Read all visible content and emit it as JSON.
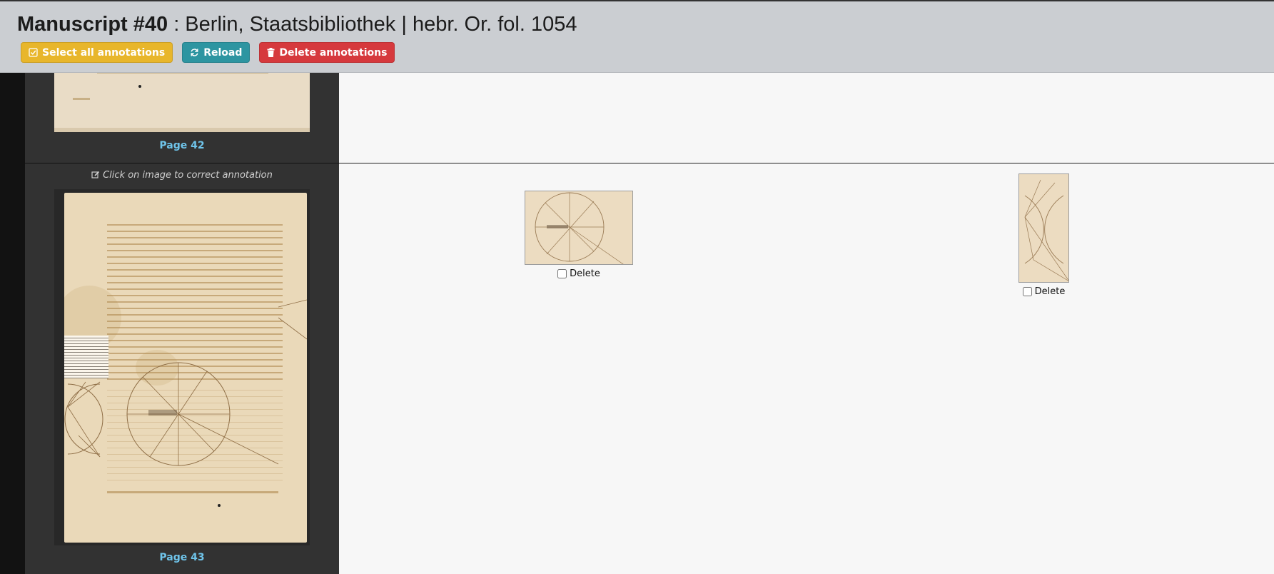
{
  "header": {
    "manuscript_label": "Manuscript #40",
    "manuscript_source": " : Berlin, Staatsbibliothek | hebr. Or. fol. 1054",
    "buttons": {
      "select_all": "Select all annotations",
      "reload": "Reload",
      "delete": "Delete annotations"
    }
  },
  "pages": [
    {
      "label": "Page 42"
    },
    {
      "label": "Page 43",
      "hint": "Click on image to correct annotation"
    }
  ],
  "annotations": [
    {
      "delete_label": "Delete",
      "checked": false
    },
    {
      "delete_label": "Delete",
      "checked": false
    }
  ],
  "colors": {
    "warning": "#e8b62b",
    "info": "#2d95a1",
    "danger": "#d6393d",
    "page_link": "#6fc4ea"
  },
  "icons": {
    "select_all": "check-square-icon",
    "reload": "refresh-icon",
    "delete": "trash-icon",
    "hint": "edit-icon"
  }
}
